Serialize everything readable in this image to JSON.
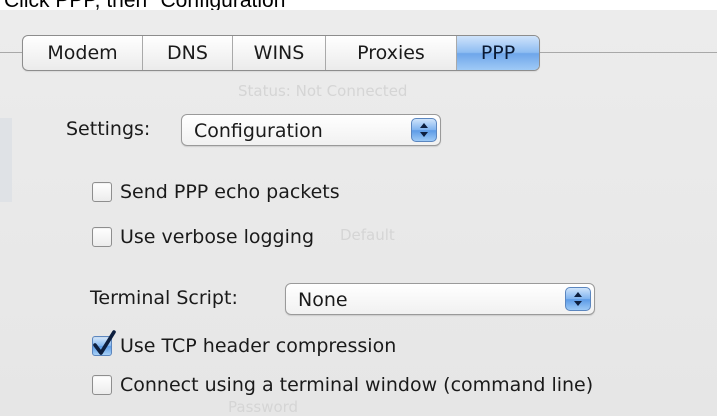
{
  "caption": "Click PPP, then \"Configuration\"",
  "tabs": [
    "Modem",
    "DNS",
    "WINS",
    "Proxies",
    "PPP"
  ],
  "active_tab": "PPP",
  "ghost_text": {
    "status": "Status:   Not Connected",
    "default": "Default",
    "password": "Password"
  },
  "settings": {
    "label": "Settings:",
    "value": "Configuration"
  },
  "options": {
    "echo": {
      "label": "Send PPP echo packets",
      "checked": false
    },
    "verbose": {
      "label": "Use verbose logging",
      "checked": false
    }
  },
  "terminal": {
    "label": "Terminal Script:",
    "value": "None"
  },
  "options2": {
    "tcp": {
      "label": "Use TCP header compression",
      "checked": true
    },
    "terminal_window": {
      "label": "Connect using a terminal window (command line)",
      "checked": false
    }
  },
  "colors": {
    "accent": "#6fa6ea",
    "panel": "#e8e8e8",
    "checkmark": "#0d1f3f"
  },
  "icons": {
    "stepper": "up-down-arrows-icon",
    "check": "checkmark-icon"
  }
}
